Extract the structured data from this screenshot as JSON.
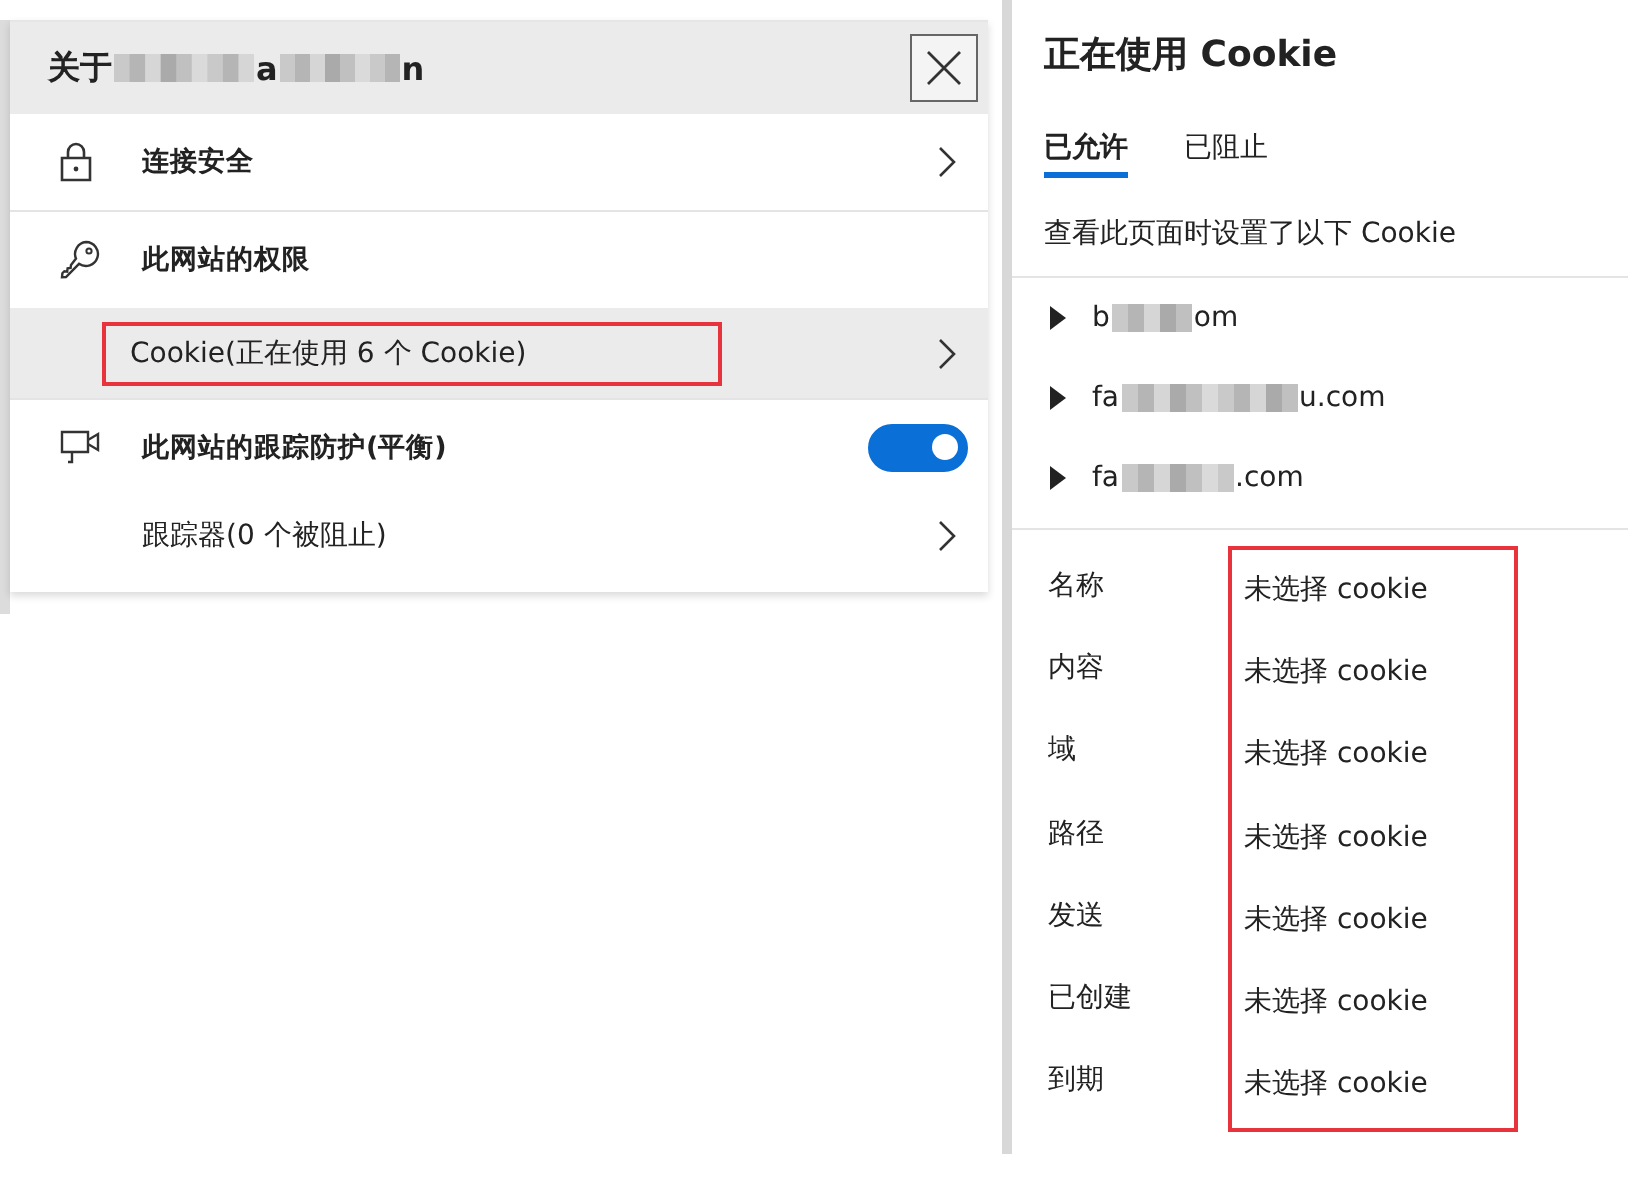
{
  "site_info": {
    "title_parts": [
      "关于",
      "a",
      "n"
    ],
    "rows": [
      {
        "kind": "link",
        "label": "连接安全",
        "bold": true,
        "selected": false,
        "highlighted": false
      },
      {
        "kind": "heading",
        "label": "此网站的权限",
        "bold": true
      },
      {
        "kind": "link",
        "label": "Cookie(正在使用 6 个 Cookie)",
        "bold": false,
        "selected": true,
        "highlighted": true
      },
      {
        "kind": "toggle",
        "label": "此网站的跟踪防护(平衡)",
        "bold": true,
        "on": true
      },
      {
        "kind": "link",
        "label": "跟踪器(0 个被阻止)",
        "bold": false,
        "selected": false,
        "highlighted": false
      }
    ]
  },
  "cookie_panel": {
    "title": "正在使用 Cookie",
    "tabs": [
      {
        "label": "已允许",
        "selected": true
      },
      {
        "label": "已阻止",
        "selected": false
      }
    ],
    "description": "查看此页面时设置了以下 Cookie",
    "domains": [
      {
        "parts": [
          "b",
          "om"
        ],
        "expanded": false
      },
      {
        "parts": [
          "fa",
          "u.com"
        ],
        "expanded": false
      },
      {
        "parts": [
          "fa",
          ".com"
        ],
        "expanded": false
      }
    ],
    "details_highlighted": true,
    "details": [
      {
        "label": "名称",
        "value": "未选择 cookie"
      },
      {
        "label": "内容",
        "value": "未选择 cookie"
      },
      {
        "label": "域",
        "value": "未选择 cookie"
      },
      {
        "label": "路径",
        "value": "未选择 cookie"
      },
      {
        "label": "发送",
        "value": "未选择 cookie"
      },
      {
        "label": "已创建",
        "value": "未选择 cookie"
      },
      {
        "label": "到期",
        "value": "未选择 cookie"
      }
    ]
  }
}
